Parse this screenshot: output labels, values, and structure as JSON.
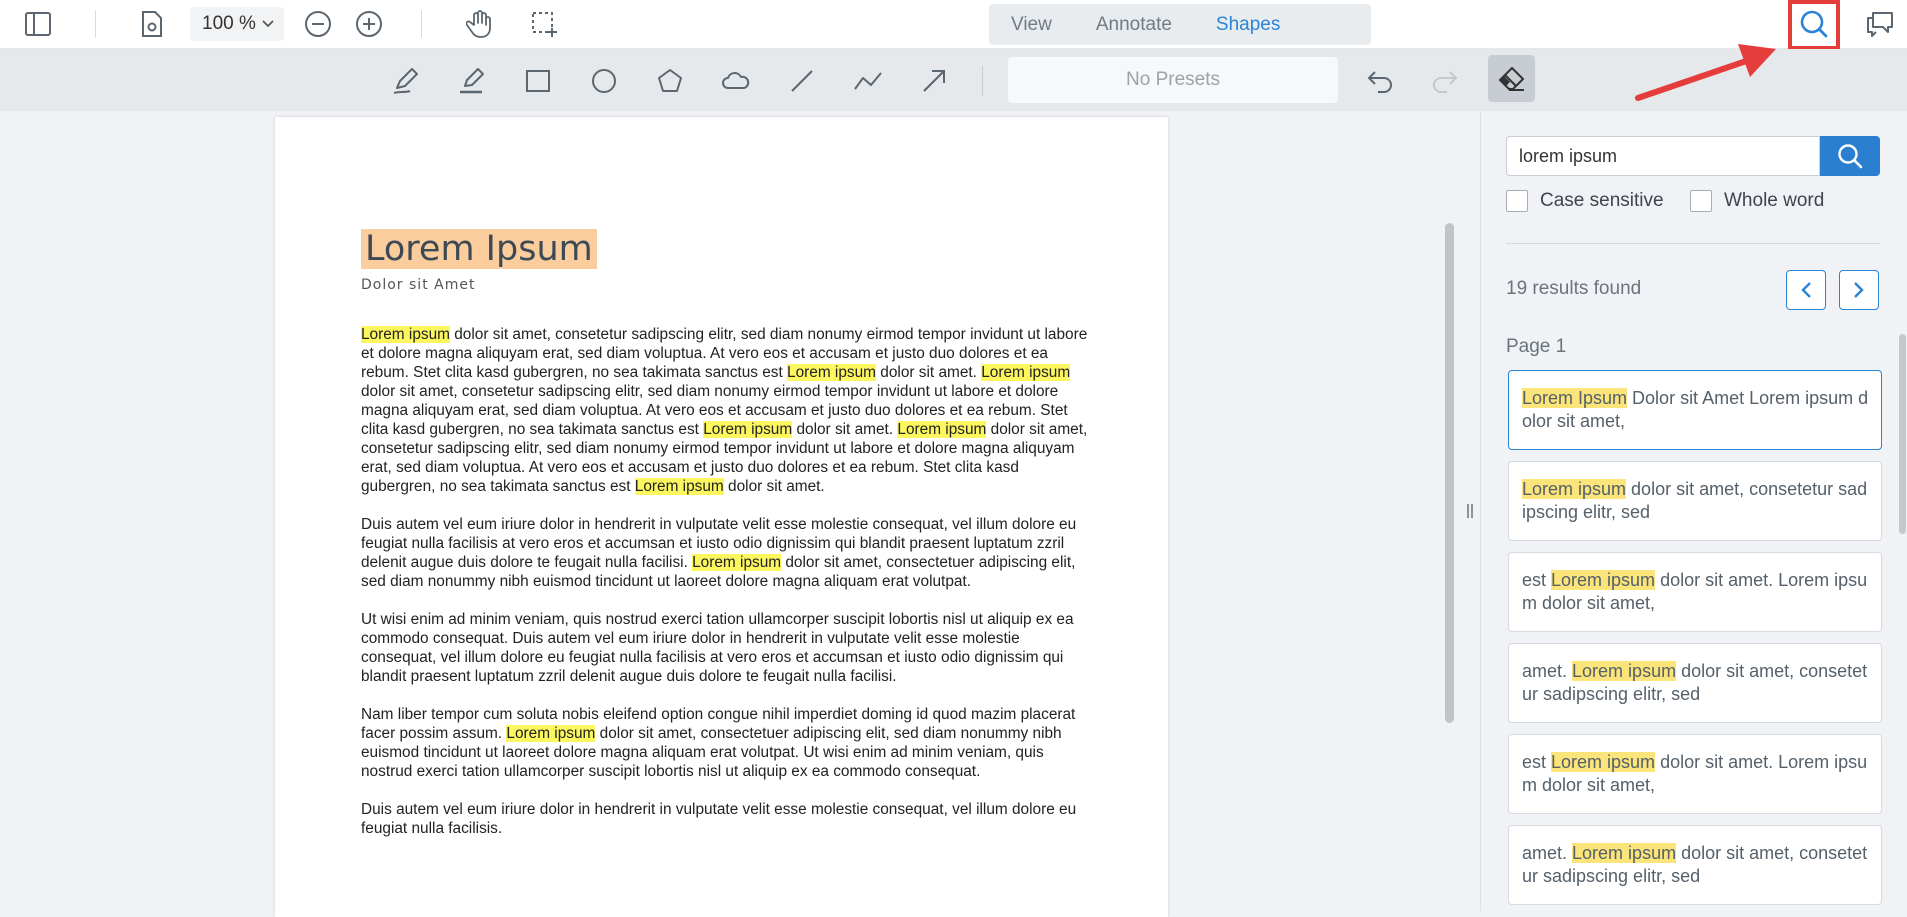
{
  "header": {
    "zoom": "100 %",
    "tabs": [
      {
        "label": "View",
        "active": false
      },
      {
        "label": "Annotate",
        "active": false
      },
      {
        "label": "Shapes",
        "active": true
      }
    ]
  },
  "toolbar": {
    "presets_label": "No Presets"
  },
  "document": {
    "title": "Lorem Ipsum",
    "subtitle": "Dolor sit Amet",
    "paragraphs": [
      [
        {
          "t": "Lorem ipsum",
          "h": true
        },
        {
          "t": " dolor sit amet, consetetur sadipscing elitr, sed diam nonumy eirmod tempor invidunt ut labore et dolore magna aliquyam erat, sed diam voluptua. At vero eos et accusam et justo duo dolores et ea rebum. Stet clita kasd gubergren, no sea takimata sanctus est "
        },
        {
          "t": "Lorem ipsum",
          "h": true
        },
        {
          "t": " dolor sit amet. "
        },
        {
          "t": "Lorem ipsum",
          "h": true
        },
        {
          "t": " dolor sit amet, consetetur sadipscing elitr, sed diam nonumy eirmod tempor invidunt ut labore et dolore magna aliquyam erat, sed diam voluptua. At vero eos et accusam et justo duo dolores et ea rebum. Stet clita kasd gubergren, no sea takimata sanctus est "
        },
        {
          "t": "Lorem ipsum",
          "h": true
        },
        {
          "t": " dolor sit amet. "
        },
        {
          "t": "Lorem ipsum",
          "h": true
        },
        {
          "t": " dolor sit amet, consetetur sadipscing elitr, sed diam nonumy eirmod tempor invidunt ut labore et dolore magna aliquyam erat, sed diam voluptua. At vero eos et accusam et justo duo dolores et ea rebum. Stet clita kasd gubergren, no sea takimata sanctus est "
        },
        {
          "t": "Lorem ipsum",
          "h": true
        },
        {
          "t": " dolor sit amet."
        }
      ],
      [
        {
          "t": "Duis autem vel eum iriure dolor in hendrerit in vulputate velit esse molestie consequat, vel illum dolore eu feugiat nulla facilisis at vero eros et accumsan et iusto odio dignissim qui blandit praesent luptatum zzril delenit augue duis dolore te feugait nulla facilisi. "
        },
        {
          "t": "Lorem ipsum",
          "h": true
        },
        {
          "t": " dolor sit amet, consectetuer adipiscing elit, sed diam nonummy nibh euismod tincidunt ut laoreet dolore magna aliquam erat volutpat."
        }
      ],
      [
        {
          "t": "Ut wisi enim ad minim veniam, quis nostrud exerci tation ullamcorper suscipit lobortis nisl ut aliquip ex ea commodo consequat. Duis autem vel eum iriure dolor in hendrerit in vulputate velit esse molestie consequat, vel illum dolore eu feugiat nulla facilisis at vero eros et accumsan et iusto odio dignissim qui blandit praesent luptatum zzril delenit augue duis dolore te feugait nulla facilisi."
        }
      ],
      [
        {
          "t": "Nam liber tempor cum soluta nobis eleifend option congue nihil imperdiet doming id quod mazim placerat facer possim assum. "
        },
        {
          "t": "Lorem ipsum",
          "h": true
        },
        {
          "t": " dolor sit amet, consectetuer adipiscing elit, sed diam nonummy nibh euismod tincidunt ut laoreet dolore magna aliquam erat volutpat. Ut wisi enim ad minim veniam, quis nostrud exerci tation ullamcorper suscipit lobortis nisl ut aliquip ex ea commodo consequat."
        }
      ],
      [
        {
          "t": "Duis autem vel eum iriure dolor in hendrerit in vulputate velit esse molestie consequat, vel illum dolore eu feugiat nulla facilisis."
        }
      ]
    ]
  },
  "search": {
    "query": "lorem ipsum",
    "case_sensitive_label": "Case sensitive",
    "whole_word_label": "Whole word",
    "results_count": "19 results found",
    "page_label": "Page 1",
    "results": [
      {
        "match": "Lorem Ipsum",
        "before": "",
        "after": " Dolor sit Amet Lorem ipsum dolor sit amet,"
      },
      {
        "match": "Lorem ipsum",
        "before": "",
        "after": " dolor sit amet, consetetur sadipscing elitr, sed"
      },
      {
        "match": "Lorem ipsum",
        "before": "est ",
        "after": " dolor sit amet. Lorem ipsum dolor sit amet,"
      },
      {
        "match": "Lorem ipsum",
        "before": "amet. ",
        "after": " dolor sit amet, consetetur sadipscing elitr, sed"
      },
      {
        "match": "Lorem ipsum",
        "before": "est ",
        "after": " dolor sit amet. Lorem ipsum dolor sit amet,"
      },
      {
        "match": "Lorem ipsum",
        "before": "amet. ",
        "after": " dolor sit amet, consetetur sadipscing elitr, sed"
      }
    ]
  },
  "colors": {
    "accent": "#2b84d6",
    "search_highlight_box": "#e53c3c",
    "doc_highlight": "#fcf75e",
    "title_highlight": "#fbcc9c"
  },
  "icons": {
    "header": [
      "sidebar-toggle-icon",
      "page-settings-icon",
      "zoom-out-icon",
      "zoom-in-icon",
      "pan-hand-icon",
      "marquee-select-icon",
      "search-icon",
      "comments-icon"
    ],
    "tools": [
      "freehand-pen-icon",
      "highlighter-pen-icon",
      "rectangle-icon",
      "ellipse-icon",
      "polygon-icon",
      "cloud-icon",
      "line-icon",
      "polyline-icon",
      "arrow-icon",
      "undo-icon",
      "redo-icon",
      "eraser-icon"
    ]
  }
}
